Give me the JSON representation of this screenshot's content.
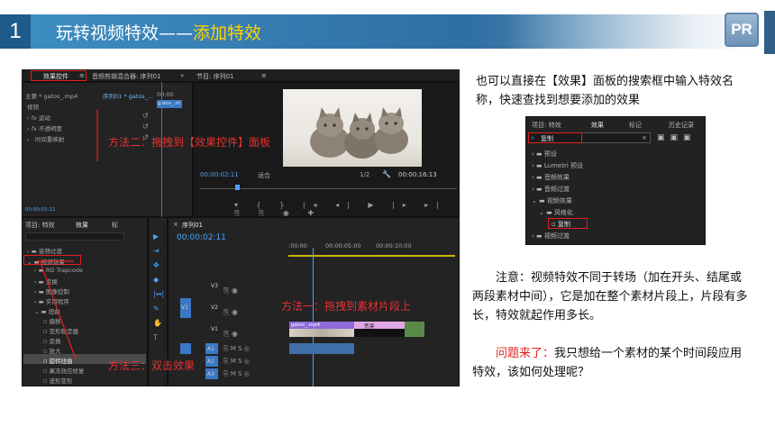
{
  "header": {
    "number": "1",
    "title_main": "玩转视频特效——",
    "title_highlight": "添加特效",
    "logo": "PR"
  },
  "colors": {
    "accent": "#3e8fc4",
    "annotation": "#e83030",
    "highlight": "#ffd400"
  },
  "premiere": {
    "effect_controls_tab": "效果控件",
    "audio_mixer_tab": "音频剪辑混合器: 序列01",
    "program_tab": "节目: 序列01",
    "source_label": "主要 * gatos_.mp4",
    "seq_label": "序列01 * gatos_...",
    "timecode_small": "00:00",
    "clip_small": "gatos_.m",
    "video_label": "视频",
    "fx_motion": "运动",
    "fx_opacity": "不透明度",
    "fx_time_remap": "时间重映射",
    "program_time_left": "00:00:02:11",
    "program_fit": "适合",
    "program_ratio": "1/2",
    "program_time_right": "00:00:16:13",
    "ec_time": "00:00:02:11",
    "proj_tabs": [
      "项目: 特效",
      "效果",
      "标"
    ],
    "effects_tree": [
      "音频过渡",
      "视频效果",
      "RG Trapcode",
      "变换",
      "图像控制",
      "实用程序",
      "扭曲",
      "偏移",
      "变形稳定器",
      "变换",
      "放大",
      "旋转扭曲",
      "果冻效应修复",
      "波形变形"
    ],
    "seq_tab": "序列01",
    "seq_time": "00:00:02:11",
    "ruler": [
      ":00:00",
      "00:00:05:00",
      "00:00:10:00"
    ],
    "tracks": [
      "V3",
      "V2",
      "V1",
      "A1",
      "A2",
      "A3"
    ],
    "v1_badge": "V1",
    "a1_badge": "A1",
    "clip1_name": "gatos_.mp4",
    "clip2_name": "荒漠",
    "annot_1": "方法一：拖拽到素材片段上",
    "annot_2": "方法二：拖拽到【效果控件】面板",
    "annot_3": "方法三：双击效果"
  },
  "right": {
    "intro": "也可以直接在【效果】面板的搜索框中输入特效名称，快速查找到想要添加的效果",
    "search_tabs": [
      "项目: 特效",
      "效果",
      "标记",
      "历史记录"
    ],
    "search_value": "复制",
    "search_tree": [
      "预设",
      "Lumetri 预设",
      "音频效果",
      "音频过渡",
      "视频效果",
      "风格化",
      "复制",
      "视频过渡"
    ],
    "note_p1": "注意：视频特效不同于转场（加在开头、结尾或两段素材中间），它是加在整个素材片段上，片段有多长，特效就起作用多长。",
    "question_red": "问题来了：",
    "question_rest": "我只想给一个素材的某个时间段应用特效，该如何处理呢？"
  }
}
